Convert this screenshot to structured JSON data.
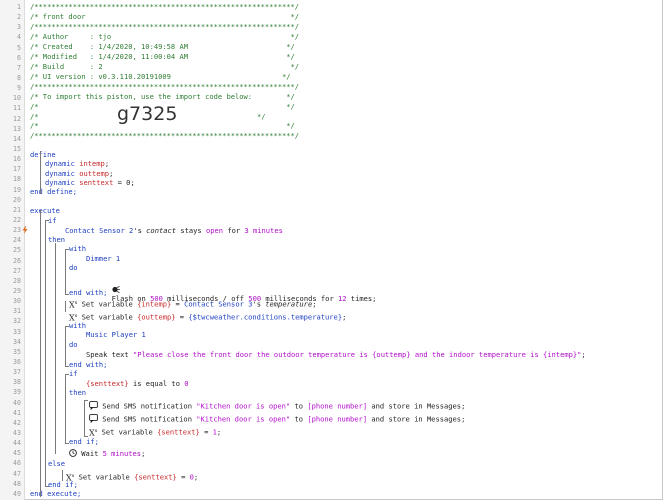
{
  "header_comment": {
    "border": "/*************************************************************/",
    "title": "/* front door                                                */",
    "author": "/* Author     : tjo                                          */",
    "created": "/* Created    : 1/4/2020, 10:49:58 AM                       */",
    "modified": "/* Modified   : 1/4/2020, 11:00:04 AM                       */",
    "build": "/* Build      : 2                                            */",
    "ui_version": "/* UI version : v0.3.110.20191009                          */",
    "import_text": "/* To import this piston, use the import code below:        */",
    "blank": "/*                                                          */",
    "code_prefix": "/*",
    "code_suffix": "*/",
    "import_code": "g7325"
  },
  "line_numbers": [
    "1",
    "2",
    "3",
    "4",
    "5",
    "6",
    "7",
    "8",
    "9",
    "10",
    "11",
    "12",
    "13",
    "14",
    "15",
    "16",
    "17",
    "18",
    "19",
    "20",
    "21",
    "22",
    "23",
    "24",
    "25",
    "26",
    "27",
    "28",
    "29",
    "30",
    "31",
    "32",
    "33",
    "34",
    "35",
    "36",
    "37",
    "38",
    "39",
    "40",
    "41",
    "42",
    "43",
    "44",
    "45",
    "46",
    "47",
    "48",
    "49"
  ],
  "code": {
    "define": "define",
    "dynamic": "dynamic",
    "var1": "intemp",
    "var2": "outtemp",
    "var3": "senttext",
    "assign0": " = 0;",
    "semi": ";",
    "end_define": "end define;",
    "execute": "execute",
    "if": "if",
    "cond_device": "Contact Sensor 2",
    "cond_attr_pre": "'s ",
    "cond_attr": "contact",
    "cond_stays": " stays ",
    "cond_value": "open",
    "cond_for": " for ",
    "cond_duration": "3 minutes",
    "then": "then",
    "with": "with",
    "device_dimmer": "Dimmer 1",
    "do": "do",
    "flash_pre": "Flash on ",
    "flash_on": "500",
    "flash_mid": " milliseconds / off ",
    "flash_off": "500",
    "flash_for": " milliseconds for ",
    "flash_times": "12",
    "flash_end": " times;",
    "end_with": "end with;",
    "set_variable": "Set variable ",
    "intemp_ref": "{intemp}",
    "eq": " = ",
    "contact3": "Contact Sensor 3",
    "temp_attr_pre": "'s ",
    "temp_attr": "temperature",
    "outtemp_ref": "{outtemp}",
    "weather_expr": "{$twcweather.conditions.temperature}",
    "device_music": "Music Player 1",
    "speak_pre": "Speak text ",
    "speak_text": "\"Please close the front door the outdoor temperature is {outtemp} and the indoor temperature is {intemp}\"",
    "senttext_ref": "{senttext}",
    "is_equal": " is equal to ",
    "zero": "0",
    "sms_pre": "Send SMS notification ",
    "sms_msg": "\"Kitchen door is open\"",
    "sms_to": " to ",
    "sms_phone": "[phone number]",
    "sms_store": " and store in Messages;",
    "one": "1",
    "end_if": "end if;",
    "wait_pre": "Wait ",
    "wait_val": "5 minutes",
    "else": "else",
    "end_execute": "end execute;"
  },
  "colors": {
    "comment": "#2e7d32",
    "keyword": "#1c3fc0",
    "string": "#b10dc9",
    "variable": "#c62828"
  }
}
